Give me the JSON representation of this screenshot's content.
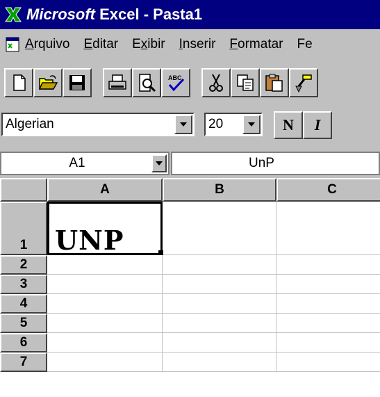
{
  "window": {
    "title_brand": "Microsoft",
    "title_rest": " Excel - Pasta1"
  },
  "menu": [
    {
      "label": "Arquivo",
      "accel": "A",
      "rest": "rquivo"
    },
    {
      "label": "Editar",
      "accel": "E",
      "rest": "ditar"
    },
    {
      "label": "Exibir",
      "pre": "E",
      "accel": "x",
      "rest": "ibir"
    },
    {
      "label": "Inserir",
      "accel": "I",
      "rest": "nserir"
    },
    {
      "label": "Formatar",
      "accel": "F",
      "rest": "ormatar"
    },
    {
      "label": "Fe",
      "accel": "",
      "rest": "Fe"
    }
  ],
  "toolbar": {
    "icons": [
      "new-icon",
      "open-icon",
      "save-icon",
      "print-icon",
      "print-preview-icon",
      "spelling-icon",
      "cut-icon",
      "copy-icon",
      "paste-icon",
      "format-painter-icon"
    ]
  },
  "format": {
    "font_name": "Algerian",
    "font_size": "20",
    "bold_label": "N",
    "italic_label": "I"
  },
  "formula": {
    "cell_ref": "A1",
    "content": "UnP"
  },
  "grid": {
    "columns": [
      "A",
      "B",
      "C"
    ],
    "rows": [
      "1",
      "2",
      "3",
      "4",
      "5",
      "6",
      "7"
    ],
    "cells": {
      "A1": "UNP"
    }
  },
  "colors": {
    "titlebar": "#000080",
    "face": "#c0c0c0",
    "excel_icon": "#00a000"
  }
}
